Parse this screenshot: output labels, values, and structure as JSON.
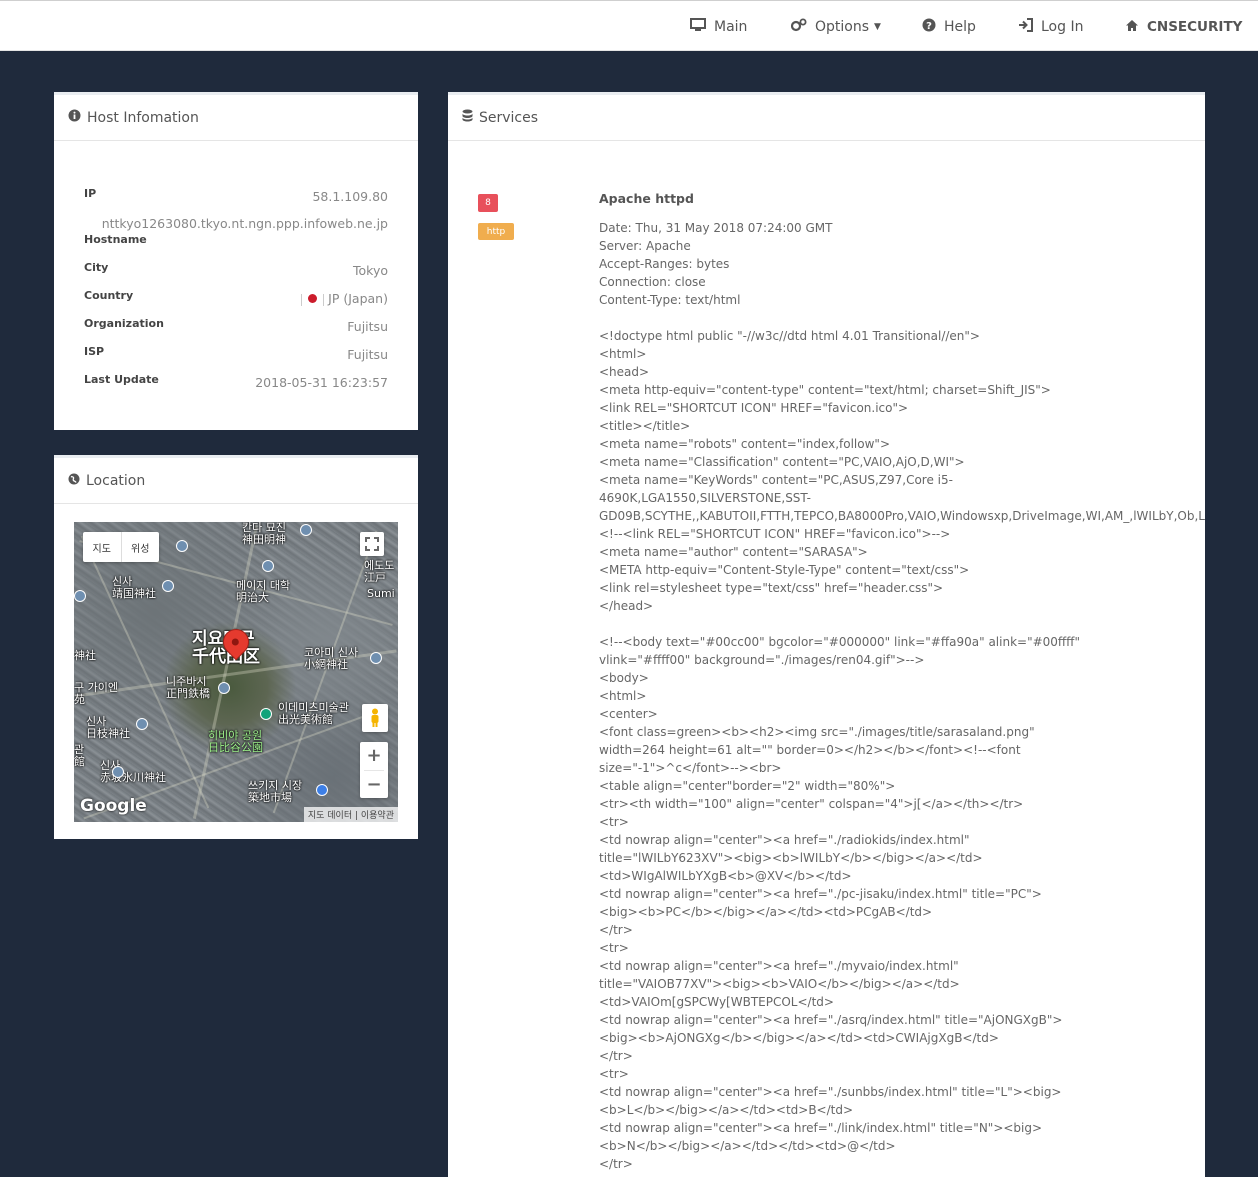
{
  "nav": {
    "items": [
      {
        "label": "Main",
        "icon": "desktop-icon"
      },
      {
        "label": "Options",
        "icon": "gears-icon",
        "caret": "▼"
      },
      {
        "label": "Help",
        "icon": "question-circle-icon"
      },
      {
        "label": "Log In",
        "icon": "sign-in-icon"
      },
      {
        "label": "CNSECURITY",
        "icon": "home-icon"
      }
    ]
  },
  "host": {
    "title": "Host Infomation",
    "rows": {
      "ip": {
        "label": "IP",
        "value": "58.1.109.80"
      },
      "hostname": {
        "label": "Hostname",
        "value": "nttkyo1263080.tkyo.nt.ngn.ppp.infoweb.ne.jp"
      },
      "city": {
        "label": "City",
        "value": "Tokyo"
      },
      "country": {
        "label": "Country",
        "value": "JP (Japan)"
      },
      "organization": {
        "label": "Organization",
        "value": "Fujitsu"
      },
      "isp": {
        "label": "ISP",
        "value": "Fujitsu"
      },
      "last_update": {
        "label": "Last Update",
        "value": "2018-05-31 16:23:57"
      }
    }
  },
  "location": {
    "title": "Location",
    "map": {
      "toggle_map": "지도",
      "toggle_satellite": "위성",
      "labels": {
        "l1": "칸다 묘진\n神田明神",
        "l2": "에도도\n江戸",
        "l3": "Sumi",
        "l4": "신사\n靖国神社",
        "l5": "메이지 대학\n明治大",
        "l6": "지요다구\n千代田区",
        "l7": "코아미 신사\n小網神社",
        "l8": "神社",
        "l9": "구 가이엔\n苑",
        "l10": "니주바시\n正門鉄橋",
        "l11": "이데미츠미술관\n出光美術館",
        "l12": "신사\n日枝神社",
        "l13": "히비야 공원\n日比谷公園",
        "l14": "관\n館",
        "l15": "신사\n赤坂氷川神社",
        "l16": "쓰키지 시장\n築地市場"
      },
      "logo": "Google",
      "attribution": "지도 데이터 | 이용약관",
      "zoom_in": "+",
      "zoom_out": "−"
    }
  },
  "services": {
    "title": "Services",
    "port": "8",
    "protocol": "http",
    "port_color": "#e8505b",
    "protocol_color": "#f0ad4e",
    "product": "Apache httpd",
    "banner": "Date: Thu, 31 May 2018 07:24:00 GMT\nServer: Apache\nAccept-Ranges: bytes\nConnection: close\nContent-Type: text/html\n\n<!doctype html public \"-//w3c//dtd html 4.01 Transitional//en\">\n<html>\n<head>\n<meta http-equiv=\"content-type\" content=\"text/html; charset=Shift_JIS\">\n<link REL=\"SHORTCUT ICON\" HREF=\"favicon.ico\">\n<title></title>\n<meta name=\"robots\" content=\"index,follow\">\n<meta name=\"Classification\" content=\"PC,VAIO,AjO,D,WI\">\n<meta name=\"KeyWords\" content=\"PC,ASUS,Z97,Core i5-\n4690K,LGA1550,SILVERSTONE,SST-\nGD09B,SCYTHE,,KABUTOII,FTTH,TEPCO,BA8000Pro,VAIO,Windowsxp,DriveImage,WI,AM_,lWILbY,Ob,L,u[hoh,A\n<!--<link REL=\"SHORTCUT ICON\" HREF=\"favicon.ico\">-->\n<meta name=\"author\" content=\"SARASA\">\n<META http-equiv=\"Content-Style-Type\" content=\"text/css\">\n<link rel=stylesheet type=\"text/css\" href=\"header.css\">\n</head>\n\n<!--<body text=\"#00cc00\" bgcolor=\"#000000\" link=\"#ffa90a\" alink=\"#00ffff\"\nvlink=\"#ffff00\" background=\"./images/ren04.gif\">-->\n<body>\n<html>\n<center>\n<font class=green><b><h2><img src=\"./images/title/sarasaland.png\"\nwidth=264 height=61 alt=\"\" border=0></h2></b></font><!--<font\nsize=\"-1\">^c</font>--><br>\n<table align=\"center\"border=\"2\" width=\"80%\">\n<tr><th width=\"100\" align=\"center\" colspan=\"4\">j[</a></th></tr>\n<tr>\n<td nowrap align=\"center\"><a href=\"./radiokids/index.html\"\ntitle=\"lWILbY623XV\"><big><b>lWILbY</b></big></a></td>\n<td>WIgAlWILbYXgB<b>@XV</b></td>\n<td nowrap align=\"center\"><a href=\"./pc-jisaku/index.html\" title=\"PC\">\n<big><b>PC</b></big></a></td><td>PCgAB</td>\n</tr>\n<tr>\n<td nowrap align=\"center\"><a href=\"./myvaio/index.html\"\ntitle=\"VAIOB77XV\"><big><b>VAIO</b></big></a></td>\n<td>VAIOm[gSPCWy[WBTEPCOL</td>\n<td nowrap align=\"center\"><a href=\"./asrq/index.html\" title=\"AjONGXgB\">\n<big><b>AjONGXg</b></big></a></td><td>CWIAjgXgB</td>\n</tr>\n<tr>\n<td nowrap align=\"center\"><a href=\"./sunbbs/index.html\" title=\"L\"><big>\n<b>L</b></big></a></td><td>B</td>\n<td nowrap align=\"center\"><a href=\"./link/index.html\" title=\"N\"><big>\n<b>N</b></big></a></td></td><td>@</td>\n</tr>"
  }
}
